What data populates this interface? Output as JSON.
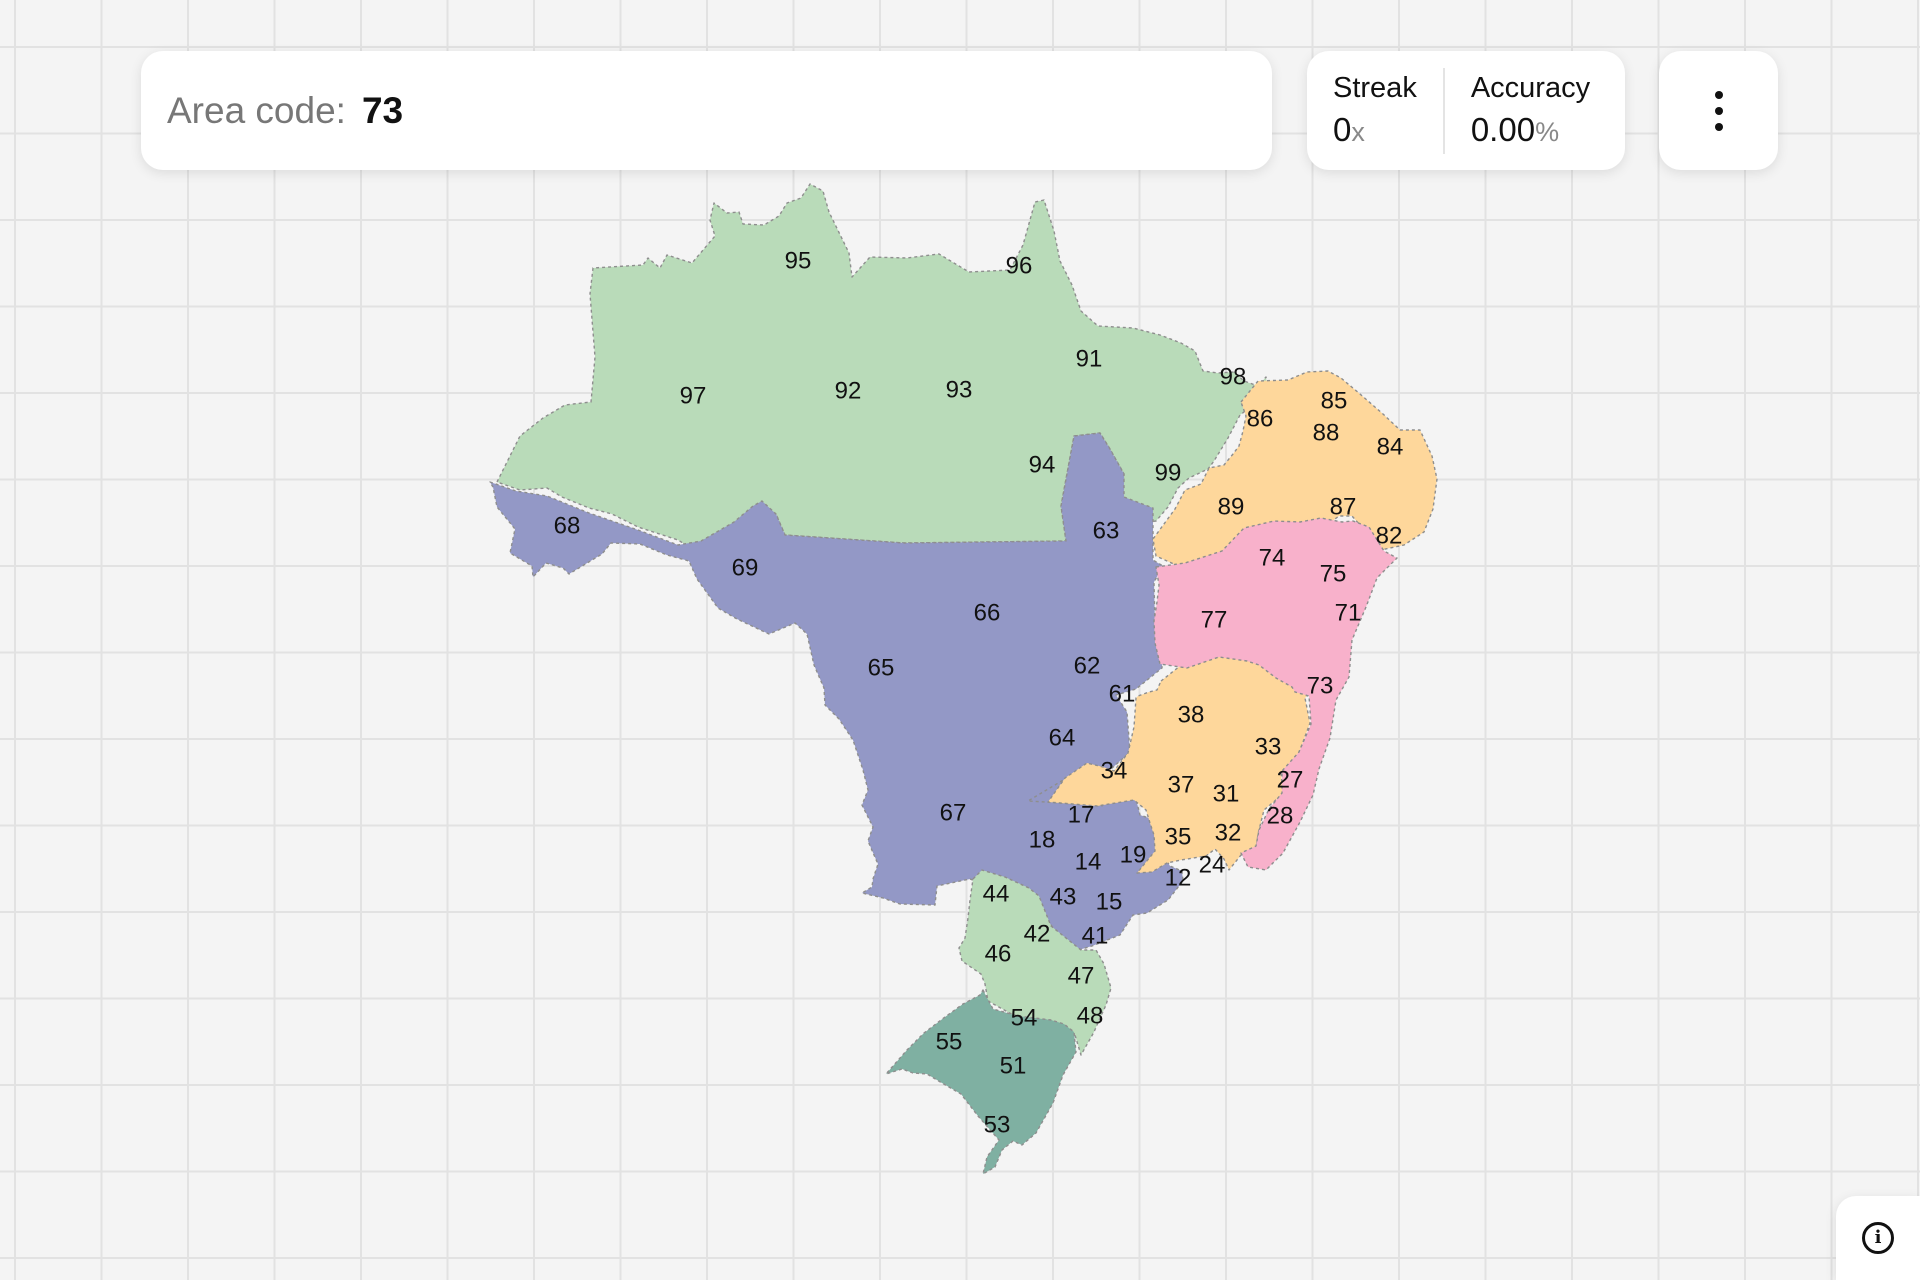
{
  "prompt": {
    "label": "Area code:",
    "value": "73"
  },
  "stats": {
    "streak": {
      "title": "Streak",
      "value": "0",
      "unit": "x"
    },
    "accuracy": {
      "title": "Accuracy",
      "value": "0.00",
      "unit": "%"
    }
  },
  "icons": {
    "menu": "more-vertical-icon",
    "info": "info-icon",
    "info_glyph": "i"
  },
  "colors": {
    "north": "#b9dbb9",
    "center_west": "#9398c6",
    "northeast": "#fed79b",
    "east": "#f8b1cb",
    "south": "#b9dbb9",
    "far_south": "#7fb0a2"
  },
  "area_codes": [
    "95",
    "96",
    "97",
    "92",
    "93",
    "91",
    "98",
    "85",
    "86",
    "88",
    "84",
    "94",
    "99",
    "89",
    "87",
    "82",
    "68",
    "63",
    "74",
    "75",
    "69",
    "71",
    "77",
    "66",
    "65",
    "62",
    "61",
    "73",
    "38",
    "64",
    "33",
    "34",
    "27",
    "37",
    "31",
    "67",
    "17",
    "28",
    "35",
    "32",
    "18",
    "14",
    "19",
    "24",
    "12",
    "44",
    "43",
    "15",
    "42",
    "41",
    "46",
    "47",
    "54",
    "48",
    "55",
    "51",
    "53"
  ]
}
